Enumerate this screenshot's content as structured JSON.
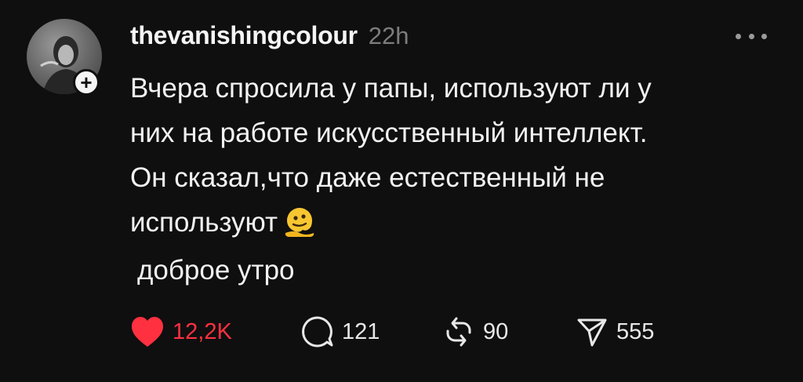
{
  "post": {
    "username": "thevanishingcolour",
    "time": "22h",
    "text": "Вчера спросила у папы, используют ли у\nних на работе искусственный интеллект.\nОн сказал,что даже естественный не\nиспользуют",
    "text2": "доброе утро",
    "emoji": "melting-face-emoji"
  },
  "actions": {
    "likes": "12,2K",
    "comments": "121",
    "reposts": "90",
    "shares": "555"
  },
  "colors": {
    "background": "#0f0f0f",
    "like": "#ff3040",
    "muted": "#7d7d7d"
  }
}
